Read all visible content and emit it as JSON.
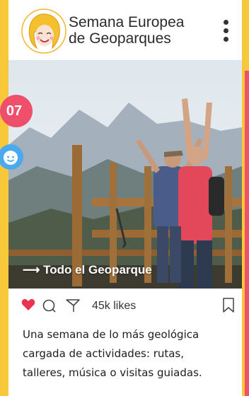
{
  "post": {
    "title_line1": "Semana Europea",
    "title_line2": "de Geoparques",
    "photo_caption": "⟶ Todo el Geoparque",
    "number_badge": "07",
    "likes": "45k likes",
    "caption_line1": "Una semana de lo más geológica",
    "caption_line2": "cargada de actividades: rutas,",
    "caption_line3": "talleres, música o visitas guiadas."
  },
  "icons": {
    "menu": "more-vertical-icon",
    "like": "heart-icon",
    "comment": "comment-icon",
    "share": "send-icon",
    "save": "bookmark-icon",
    "face": "smiley-face-icon"
  },
  "colors": {
    "background": "#f7c93a",
    "accent_pink": "#ee4f6b",
    "accent_blue": "#4aa9ef",
    "heart": "#e8344e"
  }
}
